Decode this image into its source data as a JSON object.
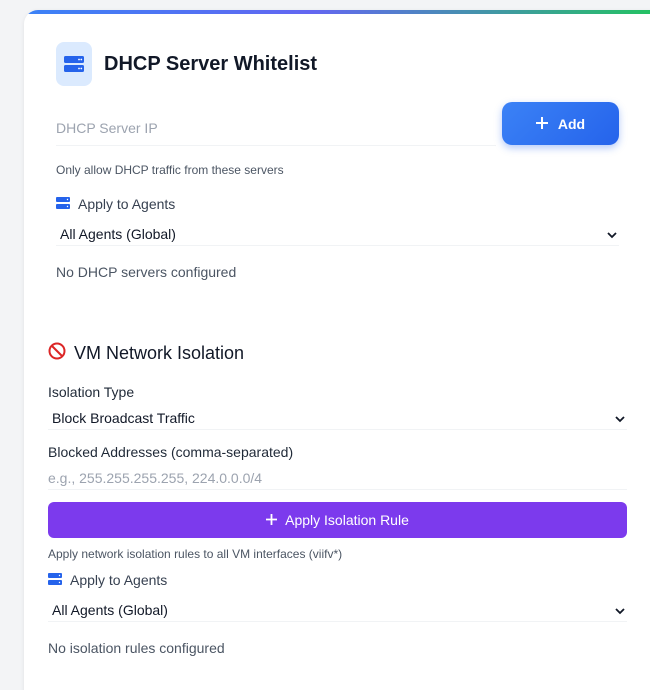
{
  "dhcp": {
    "title": "DHCP Server Whitelist",
    "ip_placeholder": "DHCP Server IP",
    "add_label": "Add",
    "hint": "Only allow DHCP traffic from these servers",
    "apply_label": "Apply to Agents",
    "agents_selected": "All Agents (Global)",
    "empty": "No DHCP servers configured"
  },
  "isolation": {
    "title": "VM Network Isolation",
    "type_label": "Isolation Type",
    "type_selected": "Block Broadcast Traffic",
    "blocked_label": "Blocked Addresses (comma-separated)",
    "blocked_placeholder": "e.g., 255.255.255.255, 224.0.0.0/4",
    "apply_button": "Apply Isolation Rule",
    "hint": "Apply network isolation rules to all VM interfaces (viifv*)",
    "apply_label": "Apply to Agents",
    "agents_selected": "All Agents (Global)",
    "empty": "No isolation rules configured"
  },
  "colors": {
    "accent_blue": "#2563eb",
    "accent_purple": "#7c3aed",
    "danger_red": "#dc2626"
  },
  "icons": {
    "header": "server-icon",
    "add": "plus-icon",
    "agents": "server-icon",
    "isolation": "prohibited-icon",
    "apply": "plus-icon",
    "select": "chevron-down-icon"
  }
}
